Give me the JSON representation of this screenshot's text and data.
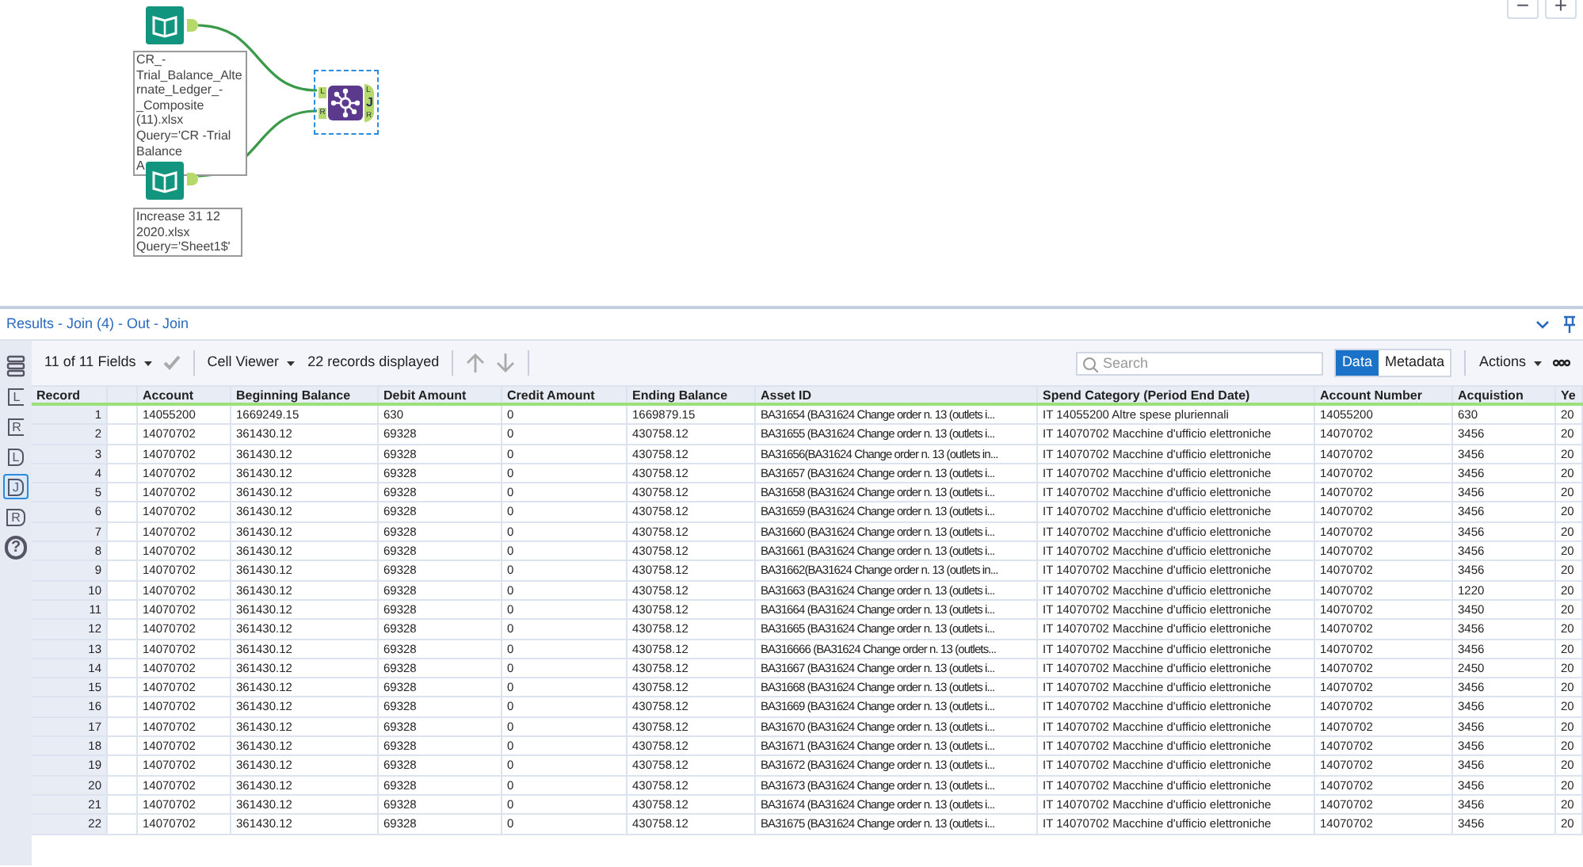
{
  "canvas": {
    "zoom_buttons": [
      "−",
      "+"
    ],
    "inputs": [
      {
        "annotation": "CR_-\nTrial_Balance_Alte\nrnate_Ledger_-\n_Composite\n(11).xlsx\nQuery='CR -Trial\nBalance\nA"
      },
      {
        "annotation": "Increase 31 12\n2020.xlsx\nQuery='Sheet1$'"
      }
    ],
    "join": {
      "selected": true,
      "inputs": [
        "L",
        "R"
      ],
      "outputs": [
        "L",
        "J",
        "R"
      ]
    }
  },
  "results": {
    "title": "Results - Join (4) - Out - Join",
    "sidebar": [
      {
        "kind": "table",
        "selected": false
      },
      {
        "kind": "sum",
        "label": "L",
        "selected": false
      },
      {
        "kind": "sum",
        "label": "R",
        "selected": false
      },
      {
        "kind": "tag",
        "label": "L",
        "selected": false
      },
      {
        "kind": "tag",
        "label": "J",
        "selected": true
      },
      {
        "kind": "tag",
        "label": "R",
        "selected": false
      },
      {
        "kind": "help",
        "label": "?",
        "selected": false
      }
    ],
    "toolbar": {
      "fields": "11 of 11 Fields",
      "viewer": "Cell Viewer",
      "records": "22 records displayed",
      "search_placeholder": "Search",
      "views": [
        {
          "label": "Data",
          "selected": true
        },
        {
          "label": "Metadata",
          "selected": false
        }
      ],
      "actions": "Actions"
    },
    "table": {
      "columns": [
        "Record",
        "",
        "Account",
        "Beginning Balance",
        "Debit Amount",
        "Credit Amount",
        "Ending Balance",
        "Asset ID",
        "Spend Category (Period End Date)",
        "Account Number",
        "Acquistion",
        "Ye"
      ],
      "rows": [
        [
          "1",
          "",
          "14055200",
          "1669249.15",
          "630",
          "0",
          "1669879.15",
          "BA31654 (BA31624 Change order n. 13 (outlets i...",
          "IT 14055200 Altre spese pluriennali",
          "14055200",
          "630",
          "20"
        ],
        [
          "2",
          "",
          "14070702",
          "361430.12",
          "69328",
          "0",
          "430758.12",
          "BA31655 (BA31624 Change order n. 13 (outlets i...",
          "IT 14070702 Macchine d'ufficio elettroniche",
          "14070702",
          "3456",
          "20"
        ],
        [
          "3",
          "",
          "14070702",
          "361430.12",
          "69328",
          "0",
          "430758.12",
          "BA31656(BA31624 Change order n. 13 (outlets in...",
          "IT 14070702 Macchine d'ufficio elettroniche",
          "14070702",
          "3456",
          "20"
        ],
        [
          "4",
          "",
          "14070702",
          "361430.12",
          "69328",
          "0",
          "430758.12",
          "BA31657 (BA31624 Change order n. 13 (outlets i...",
          "IT 14070702 Macchine d'ufficio elettroniche",
          "14070702",
          "3456",
          "20"
        ],
        [
          "5",
          "",
          "14070702",
          "361430.12",
          "69328",
          "0",
          "430758.12",
          "BA31658 (BA31624 Change order n. 13 (outlets i...",
          "IT 14070702 Macchine d'ufficio elettroniche",
          "14070702",
          "3456",
          "20"
        ],
        [
          "6",
          "",
          "14070702",
          "361430.12",
          "69328",
          "0",
          "430758.12",
          "BA31659 (BA31624 Change order n. 13 (outlets i...",
          "IT 14070702 Macchine d'ufficio elettroniche",
          "14070702",
          "3456",
          "20"
        ],
        [
          "7",
          "",
          "14070702",
          "361430.12",
          "69328",
          "0",
          "430758.12",
          "BA31660 (BA31624 Change order n. 13 (outlets i...",
          "IT 14070702 Macchine d'ufficio elettroniche",
          "14070702",
          "3456",
          "20"
        ],
        [
          "8",
          "",
          "14070702",
          "361430.12",
          "69328",
          "0",
          "430758.12",
          "BA31661 (BA31624 Change order n. 13 (outlets i...",
          "IT 14070702 Macchine d'ufficio elettroniche",
          "14070702",
          "3456",
          "20"
        ],
        [
          "9",
          "",
          "14070702",
          "361430.12",
          "69328",
          "0",
          "430758.12",
          "BA31662(BA31624 Change order n. 13 (outlets in...",
          "IT 14070702 Macchine d'ufficio elettroniche",
          "14070702",
          "3456",
          "20"
        ],
        [
          "10",
          "",
          "14070702",
          "361430.12",
          "69328",
          "0",
          "430758.12",
          "BA31663 (BA31624 Change order n. 13 (outlets i...",
          "IT 14070702 Macchine d'ufficio elettroniche",
          "14070702",
          "1220",
          "20"
        ],
        [
          "11",
          "",
          "14070702",
          "361430.12",
          "69328",
          "0",
          "430758.12",
          "BA31664 (BA31624 Change order n. 13 (outlets i...",
          "IT 14070702 Macchine d'ufficio elettroniche",
          "14070702",
          "3450",
          "20"
        ],
        [
          "12",
          "",
          "14070702",
          "361430.12",
          "69328",
          "0",
          "430758.12",
          "BA31665 (BA31624 Change order n. 13 (outlets i...",
          "IT 14070702 Macchine d'ufficio elettroniche",
          "14070702",
          "3456",
          "20"
        ],
        [
          "13",
          "",
          "14070702",
          "361430.12",
          "69328",
          "0",
          "430758.12",
          "BA316666 (BA31624 Change order n. 13 (outlets...",
          "IT 14070702 Macchine d'ufficio elettroniche",
          "14070702",
          "3456",
          "20"
        ],
        [
          "14",
          "",
          "14070702",
          "361430.12",
          "69328",
          "0",
          "430758.12",
          "BA31667 (BA31624 Change order n. 13 (outlets i...",
          "IT 14070702 Macchine d'ufficio elettroniche",
          "14070702",
          "2450",
          "20"
        ],
        [
          "15",
          "",
          "14070702",
          "361430.12",
          "69328",
          "0",
          "430758.12",
          "BA31668 (BA31624 Change order n. 13 (outlets i...",
          "IT 14070702 Macchine d'ufficio elettroniche",
          "14070702",
          "3456",
          "20"
        ],
        [
          "16",
          "",
          "14070702",
          "361430.12",
          "69328",
          "0",
          "430758.12",
          "BA31669 (BA31624 Change order n. 13 (outlets i...",
          "IT 14070702 Macchine d'ufficio elettroniche",
          "14070702",
          "3456",
          "20"
        ],
        [
          "17",
          "",
          "14070702",
          "361430.12",
          "69328",
          "0",
          "430758.12",
          "BA31670 (BA31624 Change order n. 13 (outlets i...",
          "IT 14070702 Macchine d'ufficio elettroniche",
          "14070702",
          "3456",
          "20"
        ],
        [
          "18",
          "",
          "14070702",
          "361430.12",
          "69328",
          "0",
          "430758.12",
          "BA31671 (BA31624 Change order n. 13 (outlets i...",
          "IT 14070702 Macchine d'ufficio elettroniche",
          "14070702",
          "3456",
          "20"
        ],
        [
          "19",
          "",
          "14070702",
          "361430.12",
          "69328",
          "0",
          "430758.12",
          "BA31672 (BA31624 Change order n. 13 (outlets i...",
          "IT 14070702 Macchine d'ufficio elettroniche",
          "14070702",
          "3456",
          "20"
        ],
        [
          "20",
          "",
          "14070702",
          "361430.12",
          "69328",
          "0",
          "430758.12",
          "BA31673 (BA31624 Change order n. 13 (outlets i...",
          "IT 14070702 Macchine d'ufficio elettroniche",
          "14070702",
          "3456",
          "20"
        ],
        [
          "21",
          "",
          "14070702",
          "361430.12",
          "69328",
          "0",
          "430758.12",
          "BA31674 (BA31624 Change order n. 13 (outlets i...",
          "IT 14070702 Macchine d'ufficio elettroniche",
          "14070702",
          "3456",
          "20"
        ],
        [
          "22",
          "",
          "14070702",
          "361430.12",
          "69328",
          "0",
          "430758.12",
          "BA31675 (BA31624 Change order n. 13 (outlets i...",
          "IT 14070702 Macchine d'ufficio elettroniche",
          "14070702",
          "3456",
          "20"
        ]
      ]
    }
  }
}
